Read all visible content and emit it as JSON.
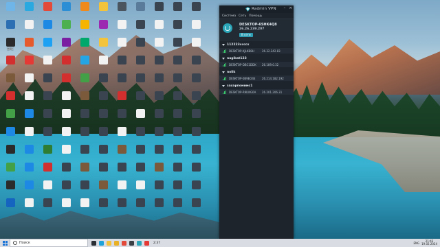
{
  "desktop": {
    "icons": [
      {
        "label": "",
        "color": "#6fb5e8",
        "icon": "recycle-bin-icon"
      },
      {
        "label": "",
        "color": "#29a9e0",
        "icon": "edge-icon"
      },
      {
        "label": "",
        "color": "#e34a3a",
        "icon": "yandex-icon"
      },
      {
        "label": "",
        "color": "#2c8fd6",
        "icon": "app-icon"
      },
      {
        "label": "",
        "color": "#f08a1c",
        "icon": "firefox-icon"
      },
      {
        "label": "",
        "color": "#f2c33b",
        "icon": "folder-icon"
      },
      {
        "label": "",
        "color": "#4b5560",
        "icon": "video-file-icon"
      },
      {
        "label": "",
        "color": "#5a7c9a",
        "icon": "image-file-icon"
      },
      {
        "label": "",
        "color": "#3a4450",
        "icon": "video-file-icon"
      },
      {
        "label": "",
        "color": "#3a4450",
        "icon": "video-file-icon"
      },
      {
        "label": "",
        "color": "#3a4450",
        "icon": "video-file-icon"
      },
      {
        "label": "",
        "color": "#2d6fb3",
        "icon": "app-icon"
      },
      {
        "label": "",
        "color": "#f2f2f2",
        "icon": "document-icon"
      },
      {
        "label": "",
        "color": "#1e88e5",
        "icon": "app-icon"
      },
      {
        "label": "",
        "color": "#4caf50",
        "icon": "app-icon"
      },
      {
        "label": "",
        "color": "#f4b400",
        "icon": "chrome-icon"
      },
      {
        "label": "",
        "color": "#9c27b0",
        "icon": "app-icon"
      },
      {
        "label": "",
        "color": "#f2f2f2",
        "icon": "document-icon"
      },
      {
        "label": "",
        "color": "#3a4450",
        "icon": "video-file-icon"
      },
      {
        "label": "",
        "color": "#f2f2f2",
        "icon": "document-icon"
      },
      {
        "label": "",
        "color": "#3a4450",
        "icon": "video-file-icon"
      },
      {
        "label": "",
        "color": "#f2f2f2",
        "icon": "document-icon"
      },
      {
        "label": "EPIC",
        "color": "#2b2b2b",
        "icon": "epic-games-icon"
      },
      {
        "label": "",
        "color": "#e55b2d",
        "icon": "app-icon"
      },
      {
        "label": "",
        "color": "#1da1f2",
        "icon": "app-icon"
      },
      {
        "label": "",
        "color": "#7b1fa2",
        "icon": "app-icon"
      },
      {
        "label": "",
        "color": "#00a86b",
        "icon": "app-icon"
      },
      {
        "label": "",
        "color": "#f2c33b",
        "icon": "folder-icon"
      },
      {
        "label": "",
        "color": "#f2f2f2",
        "icon": "document-icon"
      },
      {
        "label": "",
        "color": "#3a4450",
        "icon": "video-file-icon"
      },
      {
        "label": "",
        "color": "#f2f2f2",
        "icon": "document-icon"
      },
      {
        "label": "",
        "color": "#3a4450",
        "icon": "video-file-icon"
      },
      {
        "label": "",
        "color": "#f2f2f2",
        "icon": "document-icon"
      },
      {
        "label": "",
        "color": "#d32f2f",
        "icon": "app-icon"
      },
      {
        "label": "",
        "color": "#e53935",
        "icon": "app-icon"
      },
      {
        "label": "",
        "color": "#f2f2f2",
        "icon": "document-icon"
      },
      {
        "label": "",
        "color": "#d32f2f",
        "icon": "app-icon"
      },
      {
        "label": "",
        "color": "#26a5e4",
        "icon": "telegram-icon"
      },
      {
        "label": "",
        "color": "#f2f2f2",
        "icon": "document-icon"
      },
      {
        "label": "",
        "color": "#3a4450",
        "icon": "video-file-icon"
      },
      {
        "label": "",
        "color": "#3a4450",
        "icon": "video-file-icon"
      },
      {
        "label": "",
        "color": "#3a4450",
        "icon": "video-file-icon"
      },
      {
        "label": "",
        "color": "#3a4450",
        "icon": "video-file-icon"
      },
      {
        "label": "",
        "color": "#3a4450",
        "icon": "video-file-icon"
      },
      {
        "label": "",
        "color": "#7a5a3a",
        "icon": "archive-icon"
      },
      {
        "label": "",
        "color": "#f2f2f2",
        "icon": "document-icon"
      },
      {
        "label": "",
        "color": "#3a4450",
        "icon": "video-file-icon"
      },
      {
        "label": "",
        "color": "#d32f2f",
        "icon": "app-icon"
      },
      {
        "label": "",
        "color": "#43a047",
        "icon": "app-icon"
      },
      {
        "label": "",
        "color": "#3a4450",
        "icon": "video-file-icon"
      },
      {
        "label": "",
        "color": "#3a4450",
        "icon": "video-file-icon"
      },
      {
        "label": "",
        "color": "#3a4450",
        "icon": "video-file-icon"
      },
      {
        "label": "",
        "color": "#3a4450",
        "icon": "video-file-icon"
      },
      {
        "label": "",
        "color": "#3a4450",
        "icon": "video-file-icon"
      },
      {
        "label": "",
        "color": "#3a4450",
        "icon": "video-file-icon"
      },
      {
        "label": "",
        "color": "#d32f2f",
        "icon": "app-icon"
      },
      {
        "label": "",
        "color": "#f2f2f2",
        "icon": "document-icon"
      },
      {
        "label": "",
        "color": "#3a4450",
        "icon": "video-file-icon"
      },
      {
        "label": "",
        "color": "#f2f2f2",
        "icon": "document-icon"
      },
      {
        "label": "",
        "color": "#7a5a3a",
        "icon": "archive-icon"
      },
      {
        "label": "",
        "color": "#3a4450",
        "icon": "video-file-icon"
      },
      {
        "label": "",
        "color": "#d32f2f",
        "icon": "app-icon"
      },
      {
        "label": "",
        "color": "#3a4450",
        "icon": "video-file-icon"
      },
      {
        "label": "",
        "color": "#3a4450",
        "icon": "video-file-icon"
      },
      {
        "label": "",
        "color": "#3a4450",
        "icon": "video-file-icon"
      },
      {
        "label": "",
        "color": "#3a4450",
        "icon": "video-file-icon"
      },
      {
        "label": "",
        "color": "#43a047",
        "icon": "app-icon"
      },
      {
        "label": "",
        "color": "#1e88e5",
        "icon": "app-icon"
      },
      {
        "label": "",
        "color": "#3a4450",
        "icon": "video-file-icon"
      },
      {
        "label": "",
        "color": "#f2f2f2",
        "icon": "document-icon"
      },
      {
        "label": "",
        "color": "#3a4450",
        "icon": "video-file-icon"
      },
      {
        "label": "",
        "color": "#3a4450",
        "icon": "video-file-icon"
      },
      {
        "label": "",
        "color": "#3a4450",
        "icon": "video-file-icon"
      },
      {
        "label": "",
        "color": "#f2f2f2",
        "icon": "document-icon"
      },
      {
        "label": "",
        "color": "#3a4450",
        "icon": "video-file-icon"
      },
      {
        "label": "",
        "color": "#3a4450",
        "icon": "video-file-icon"
      },
      {
        "label": "",
        "color": "#3a4450",
        "icon": "video-file-icon"
      },
      {
        "label": "",
        "color": "#1e88e5",
        "icon": "app-icon"
      },
      {
        "label": "",
        "color": "#f2f2f2",
        "icon": "document-icon"
      },
      {
        "label": "",
        "color": "#3a4450",
        "icon": "video-file-icon"
      },
      {
        "label": "",
        "color": "#f2f2f2",
        "icon": "document-icon"
      },
      {
        "label": "",
        "color": "#3a4450",
        "icon": "video-file-icon"
      },
      {
        "label": "",
        "color": "#3a4450",
        "icon": "video-file-icon"
      },
      {
        "label": "",
        "color": "#f2f2f2",
        "icon": "document-icon"
      },
      {
        "label": "",
        "color": "#3a4450",
        "icon": "video-file-icon"
      },
      {
        "label": "",
        "color": "#3a4450",
        "icon": "video-file-icon"
      },
      {
        "label": "",
        "color": "#3a4450",
        "icon": "video-file-icon"
      },
      {
        "label": "",
        "color": "#3a4450",
        "icon": "video-file-icon"
      },
      {
        "label": "",
        "color": "#2b2b2b",
        "icon": "app-icon"
      },
      {
        "label": "",
        "color": "#1e88e5",
        "icon": "app-icon"
      },
      {
        "label": "",
        "color": "#2e7d32",
        "icon": "app-icon"
      },
      {
        "label": "",
        "color": "#f2f2f2",
        "icon": "document-icon"
      },
      {
        "label": "",
        "color": "#3a4450",
        "icon": "video-file-icon"
      },
      {
        "label": "",
        "color": "#3a4450",
        "icon": "video-file-icon"
      },
      {
        "label": "",
        "color": "#7a5a3a",
        "icon": "archive-icon"
      },
      {
        "label": "",
        "color": "#3a4450",
        "icon": "video-file-icon"
      },
      {
        "label": "",
        "color": "#3a4450",
        "icon": "video-file-icon"
      },
      {
        "label": "",
        "color": "#3a4450",
        "icon": "video-file-icon"
      },
      {
        "label": "",
        "color": "#3a4450",
        "icon": "video-file-icon"
      },
      {
        "label": "",
        "color": "#43a047",
        "icon": "app-icon"
      },
      {
        "label": "",
        "color": "#1e88e5",
        "icon": "app-icon"
      },
      {
        "label": "",
        "color": "#d32f2f",
        "icon": "app-icon"
      },
      {
        "label": "",
        "color": "#3a4450",
        "icon": "video-file-icon"
      },
      {
        "label": "",
        "color": "#7a5a3a",
        "icon": "archive-icon"
      },
      {
        "label": "",
        "color": "#3a4450",
        "icon": "video-file-icon"
      },
      {
        "label": "",
        "color": "#3a4450",
        "icon": "video-file-icon"
      },
      {
        "label": "",
        "color": "#3a4450",
        "icon": "video-file-icon"
      },
      {
        "label": "",
        "color": "#7a5a3a",
        "icon": "archive-icon"
      },
      {
        "label": "",
        "color": "#3a4450",
        "icon": "video-file-icon"
      },
      {
        "label": "",
        "color": "#3a4450",
        "icon": "video-file-icon"
      },
      {
        "label": "",
        "color": "#2b2b2b",
        "icon": "app-icon"
      },
      {
        "label": "",
        "color": "#1e88e5",
        "icon": "app-icon"
      },
      {
        "label": "",
        "color": "#f2f2f2",
        "icon": "document-icon"
      },
      {
        "label": "",
        "color": "#3a4450",
        "icon": "video-file-icon"
      },
      {
        "label": "",
        "color": "#3a4450",
        "icon": "video-file-icon"
      },
      {
        "label": "",
        "color": "#7a5a3a",
        "icon": "archive-icon"
      },
      {
        "label": "",
        "color": "#f2f2f2",
        "icon": "document-icon"
      },
      {
        "label": "",
        "color": "#f2f2f2",
        "icon": "document-icon"
      },
      {
        "label": "",
        "color": "#3a4450",
        "icon": "video-file-icon"
      },
      {
        "label": "",
        "color": "#3a4450",
        "icon": "video-file-icon"
      },
      {
        "label": "",
        "color": "#3a4450",
        "icon": "video-file-icon"
      },
      {
        "label": "",
        "color": "#1565c0",
        "icon": "app-icon"
      },
      {
        "label": "",
        "color": "#f2f2f2",
        "icon": "document-icon"
      },
      {
        "label": "",
        "color": "#3a4450",
        "icon": "video-file-icon"
      },
      {
        "label": "",
        "color": "#f2f2f2",
        "icon": "document-icon"
      },
      {
        "label": "",
        "color": "#f2f2f2",
        "icon": "document-icon"
      },
      {
        "label": "",
        "color": "#3a4450",
        "icon": "video-file-icon"
      },
      {
        "label": "",
        "color": "#3a4450",
        "icon": "video-file-icon"
      },
      {
        "label": "",
        "color": "#3a4450",
        "icon": "video-file-icon"
      },
      {
        "label": "",
        "color": "#3a4450",
        "icon": "video-file-icon"
      },
      {
        "label": "",
        "color": "#3a4450",
        "icon": "video-file-icon"
      },
      {
        "label": "",
        "color": "#3a4450",
        "icon": "video-file-icon"
      }
    ]
  },
  "vpn": {
    "title": "Radmin VPN",
    "window_buttons": [
      "–",
      "×"
    ],
    "menu": [
      "Система",
      "Сеть",
      "Помощь"
    ],
    "host": {
      "name": "DESKTOP-6SHK4Q8",
      "ip": "26.26.239.207",
      "status": "В сети"
    },
    "networks": [
      {
        "name": "112223ccccx",
        "peers": [
          {
            "name": "DESKTOP-KJLKB8H",
            "ip": "26.32.242.83"
          }
        ]
      },
      {
        "name": "nagibat123",
        "peers": [
          {
            "name": "DESKTOP-DBC1DDK",
            "ip": "26.189.0.32"
          }
        ]
      },
      {
        "name": "nolik",
        "peers": [
          {
            "name": "DESKTOP-0B9EO4E",
            "ip": "26.214.182.192"
          }
        ]
      },
      {
        "name": "захарпомимс1",
        "peers": [
          {
            "name": "DESKTOP-R9LWG0A",
            "ip": "26.201.206.31"
          }
        ]
      }
    ]
  },
  "taskbar": {
    "search_placeholder": "Поиск",
    "apps": [
      {
        "icon": "task-view-icon",
        "color": "#2a2f36"
      },
      {
        "icon": "edge-icon",
        "color": "#1fa3d8"
      },
      {
        "icon": "file-explorer-icon",
        "color": "#f2c33b"
      },
      {
        "icon": "chrome-icon",
        "color": "#e9b128"
      },
      {
        "icon": "yandex-browser-icon",
        "color": "#e34a3a"
      },
      {
        "icon": "app-icon",
        "color": "#3a3f46"
      },
      {
        "icon": "radmin-icon",
        "color": "#2aa6b8"
      },
      {
        "icon": "youtube-icon",
        "color": "#e53935"
      }
    ],
    "media_time": "2:37",
    "tray": {
      "lang": "ENG",
      "time": "21:43",
      "date": "19.02.2024"
    }
  }
}
